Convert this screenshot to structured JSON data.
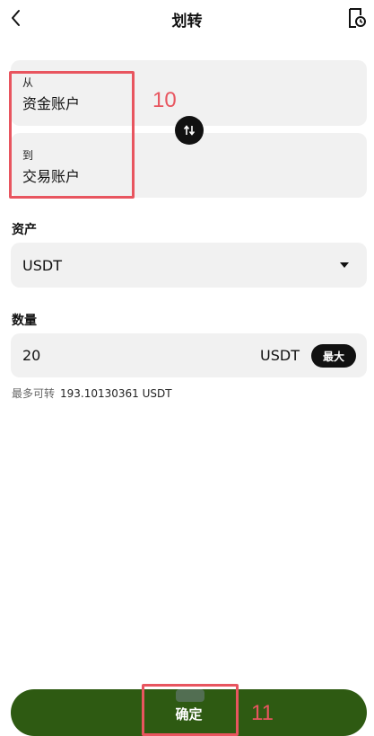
{
  "header": {
    "title": "划转",
    "back_icon": "chevron-left-icon",
    "record_icon": "document-clock-icon"
  },
  "transfer": {
    "from_label": "从",
    "from_value": "资金账户",
    "to_label": "到",
    "to_value": "交易账户",
    "swap_icon": "swap-arrows-icon"
  },
  "asset": {
    "label": "资产",
    "selected": "USDT"
  },
  "quantity": {
    "label": "数量",
    "value": "20",
    "unit": "USDT",
    "max_label": "最大"
  },
  "available": {
    "label": "最多可转",
    "amount": "193.10130361 USDT"
  },
  "confirm": {
    "label": "确定"
  },
  "annotations": {
    "box_10": "10",
    "box_11": "11",
    "color": "#e8555f"
  },
  "colors": {
    "primary_button": "#2e5a12",
    "field_bg": "#f1f1f1",
    "max_button": "#111111"
  }
}
